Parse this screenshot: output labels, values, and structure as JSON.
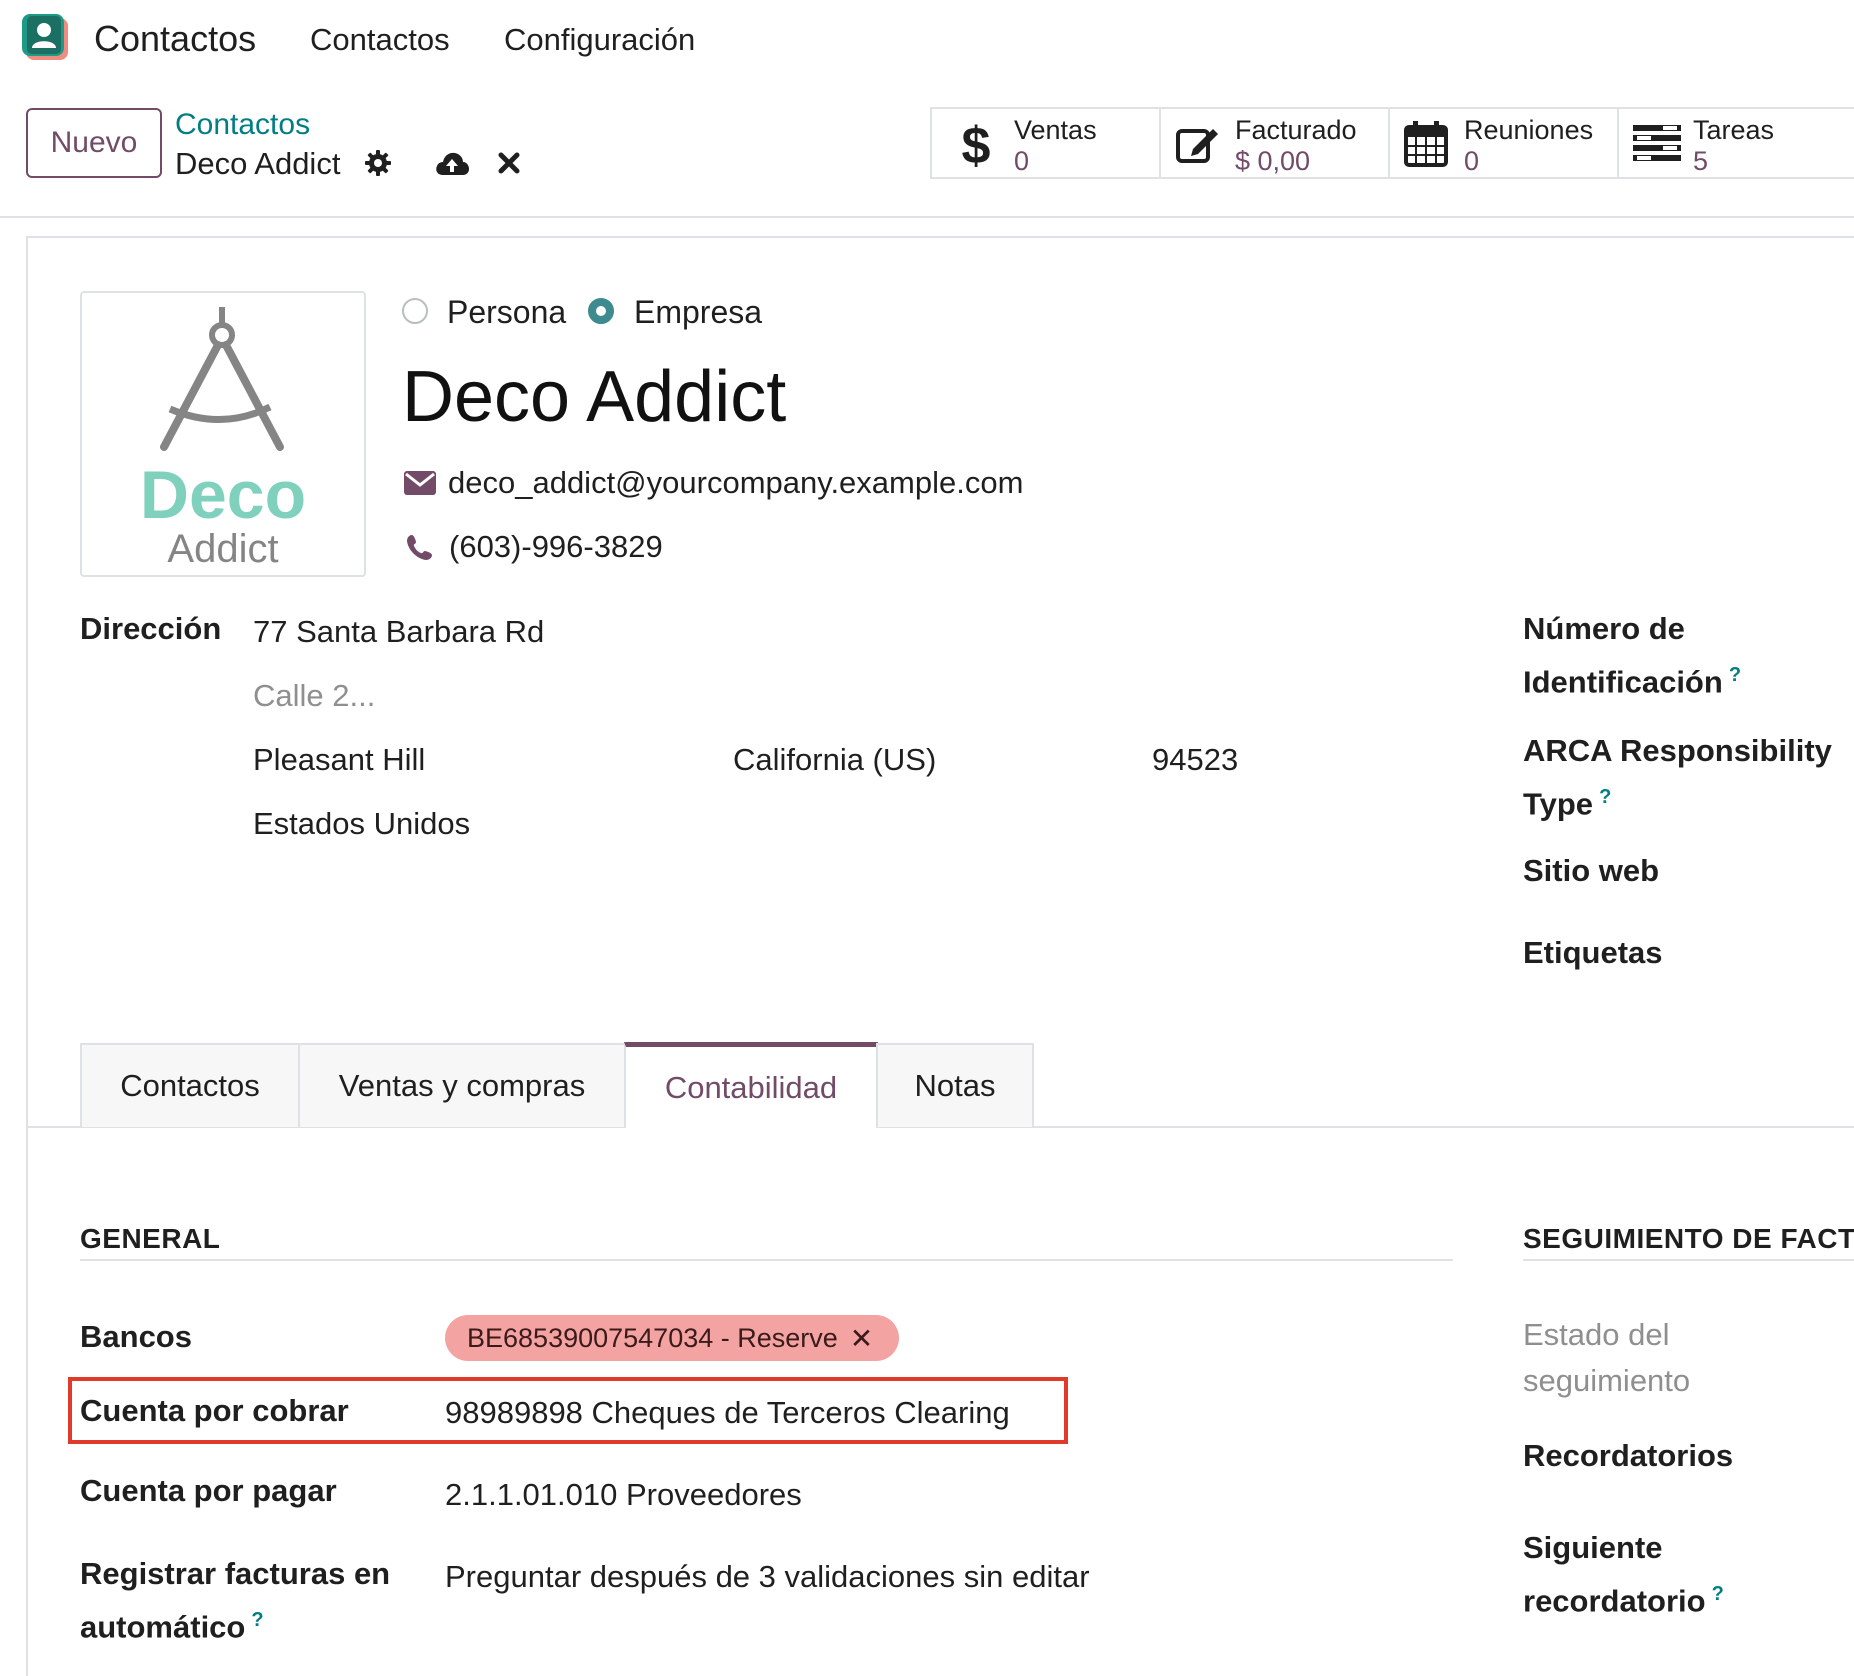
{
  "nav": {
    "app_title": "Contactos",
    "menu": [
      "Contactos",
      "Configuración"
    ]
  },
  "control_panel": {
    "new_button": "Nuevo",
    "breadcrumb_parent": "Contactos",
    "breadcrumb_current": "Deco Addict",
    "icons": [
      "gear-icon",
      "cloud-upload-icon",
      "close-icon"
    ],
    "stat_buttons": [
      {
        "icon": "dollar-icon",
        "label": "Ventas",
        "value": "0"
      },
      {
        "icon": "edit-icon",
        "label": "Facturado",
        "value": "$ 0,00"
      },
      {
        "icon": "calendar-icon",
        "label": "Reuniones",
        "value": "0"
      },
      {
        "icon": "tasks-icon",
        "label": "Tareas",
        "value": "5"
      }
    ]
  },
  "partner": {
    "logo_text_1": "Deco",
    "logo_text_2": "Addict",
    "type_options": [
      "Persona",
      "Empresa"
    ],
    "selected_type": "Empresa",
    "name": "Deco Addict",
    "email": "deco_addict@yourcompany.example.com",
    "phone": "(603)-996-3829"
  },
  "address": {
    "label": "Dirección",
    "street": "77 Santa Barbara Rd",
    "street2_placeholder": "Calle 2...",
    "city": "Pleasant Hill",
    "state": "California (US)",
    "zip": "94523",
    "country": "Estados Unidos"
  },
  "right_fields": {
    "id_number_1": "Número de",
    "id_number_2": "Identificación",
    "arca_1": "ARCA Responsibility",
    "arca_2": "Type",
    "website": "Sitio web",
    "tags": "Etiquetas",
    "help_mark": "?"
  },
  "tabs": [
    "Contactos",
    "Ventas y compras",
    "Contabilidad",
    "Notas"
  ],
  "active_tab": "Contabilidad",
  "accounting": {
    "general_title": "GENERAL",
    "followup_title": "SEGUIMIENTO DE FACT",
    "banks_label": "Bancos",
    "bank_tag": "BE68539007547034 - Reserve",
    "receivable_label": "Cuenta por cobrar",
    "receivable_value": "98989898 Cheques de Terceros Clearing",
    "payable_label": "Cuenta por pagar",
    "payable_value": "2.1.1.01.010 Proveedores",
    "autopost_label_1": "Registrar facturas en",
    "autopost_label_2": "automático",
    "autopost_value": "Preguntar después de 3 validaciones sin editar",
    "followup_status_1": "Estado del",
    "followup_status_2": "seguimiento",
    "reminders": "Recordatorios",
    "next_reminder_1": "Siguiente",
    "next_reminder_2": "recordatorio"
  },
  "colors": {
    "primary": "#714B67",
    "teal": "#017e84",
    "tag_bg": "#f4a3a3",
    "highlight": "#e03a2a"
  }
}
